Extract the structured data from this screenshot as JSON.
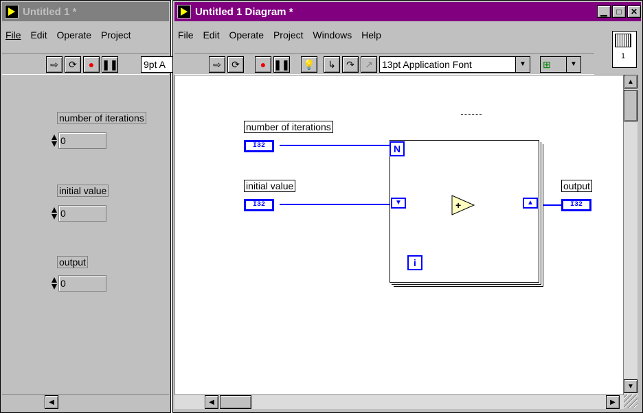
{
  "front_panel": {
    "title": "Untitled 1 *",
    "menu": [
      "File",
      "Edit",
      "Operate",
      "Project"
    ],
    "font_field": "9pt A",
    "controls": [
      {
        "label": "number of iterations",
        "value": "0"
      },
      {
        "label": "initial value",
        "value": "0"
      },
      {
        "label": "output",
        "value": "0"
      }
    ]
  },
  "diagram": {
    "title": "Untitled 1 Diagram *",
    "menu": [
      "File",
      "Edit",
      "Operate",
      "Project",
      "Windows",
      "Help"
    ],
    "font_select": "13pt Application Font",
    "connector_pane_number": "1",
    "terminals": {
      "iterations_label": "number of iterations",
      "initial_label": "initial value",
      "output_label": "output",
      "type": "I32"
    },
    "for_loop": {
      "count_terminal": "N",
      "index_terminal": "i",
      "add_symbol": "+"
    }
  },
  "colors": {
    "wire": "#0000ff",
    "active_title": "#800080",
    "inactive_title": "#808080",
    "add_node": "#ffffc0"
  },
  "icons": [
    "run-arrow-icon",
    "run-continuous-icon",
    "abort-icon",
    "pause-icon",
    "highlight-execution-icon",
    "step-into-icon",
    "step-over-icon",
    "step-out-icon",
    "connector-pane-icon"
  ]
}
